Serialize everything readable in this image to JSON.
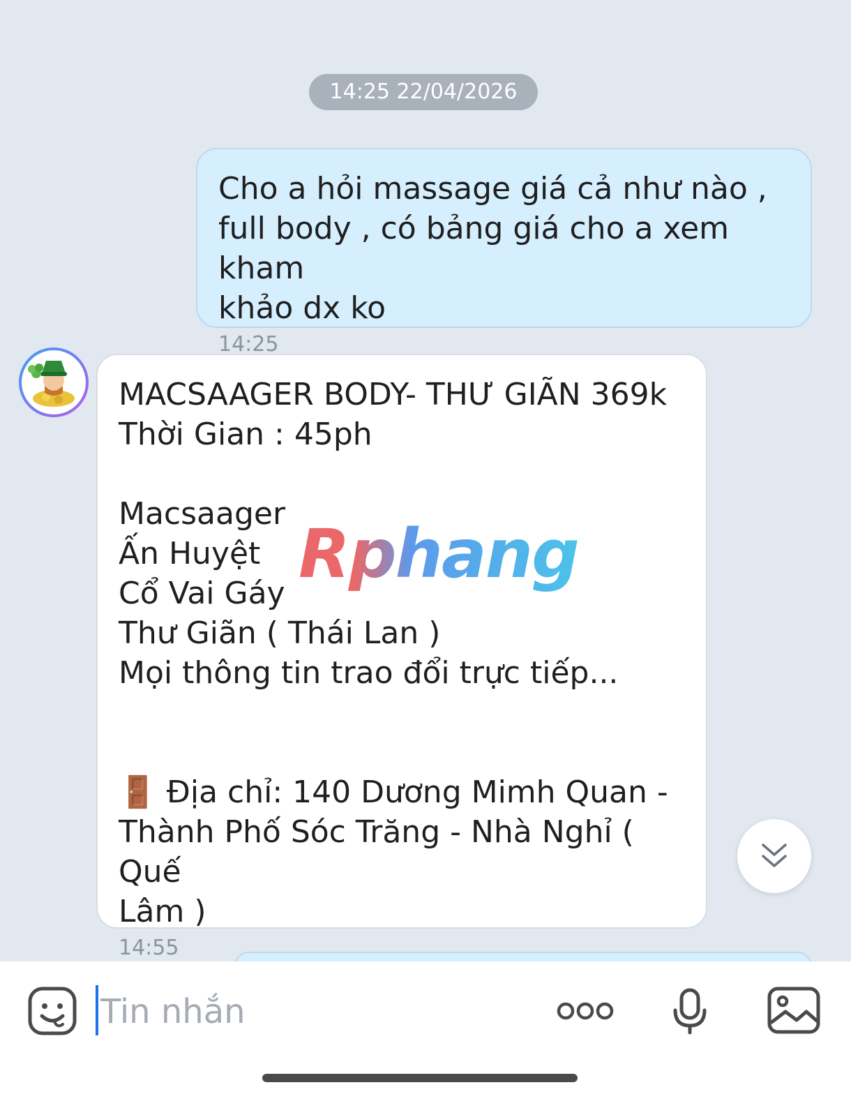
{
  "chat": {
    "date_divider": "14:25 22/04/2026",
    "messages": [
      {
        "direction": "outgoing",
        "text": "Cho a hỏi massage giá cả như nào ,\nfull body , có bảng giá cho a xem kham\nkhảo dx ko",
        "time": "14:25"
      },
      {
        "direction": "incoming",
        "text": "MACSAAGER BODY- THƯ GIÃN 369k\nThời Gian : 45ph\n\nMacsaager\nẤn Huyệt\nCổ Vai Gáy\nThư Giãn ( Thái Lan )\nMọi thông tin trao đổi trực tiếp...\n\n\n🚪 Địa chỉ: 140 Dương Mimh Quan -\nThành Phố Sóc Trăng - Nhà Nghỉ ( Quế\nLâm )",
        "time": "14:55"
      }
    ],
    "watermark": "Rphang"
  },
  "composer": {
    "placeholder": "Tin nhắn",
    "icons": [
      "sticker-icon",
      "more-icon",
      "microphone-icon",
      "image-icon"
    ]
  },
  "colors": {
    "background": "#e2e8f0",
    "outgoing_bubble": "#d5efff",
    "incoming_bubble": "#ffffff",
    "accent": "#1a73e8"
  }
}
